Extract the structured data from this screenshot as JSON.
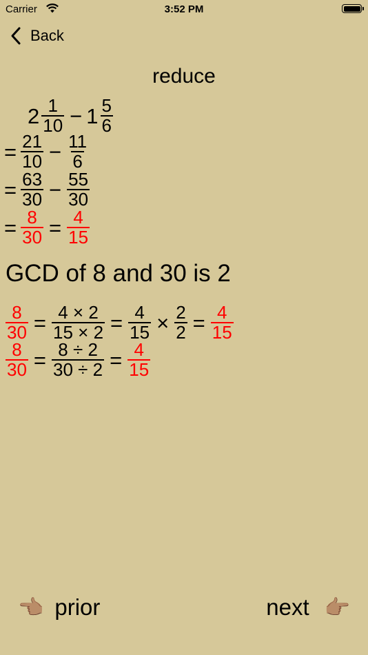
{
  "status": {
    "carrier": "Carrier",
    "time": "3:52 PM"
  },
  "nav": {
    "back_label": "Back"
  },
  "title": "reduce",
  "problem": {
    "a_whole": "2",
    "a_num": "1",
    "a_den": "10",
    "op": "−",
    "b_whole": "1",
    "b_num": "5",
    "b_den": "6"
  },
  "step1": {
    "eq": "=",
    "a_num": "21",
    "a_den": "10",
    "op": "−",
    "b_num": "11",
    "b_den": "6"
  },
  "step2": {
    "eq": "=",
    "a_num": "63",
    "a_den": "30",
    "op": "−",
    "b_num": "55",
    "b_den": "30"
  },
  "step3": {
    "eq": "=",
    "a_num": "8",
    "a_den": "30",
    "eq2": "=",
    "b_num": "4",
    "b_den": "15"
  },
  "gcd_text": "GCD of 8 and 30 is 2",
  "mult": {
    "f1_num": "8",
    "f1_den": "30",
    "eq": "=",
    "f2_num": "4 × 2",
    "f2_den": "15 × 2",
    "eq2": "=",
    "f3_num": "4",
    "f3_den": "15",
    "times": "×",
    "f4_num": "2",
    "f4_den": "2",
    "eq3": "=",
    "f5_num": "4",
    "f5_den": "15"
  },
  "div": {
    "f1_num": "8",
    "f1_den": "30",
    "eq": "=",
    "f2_num": "8 ÷ 2",
    "f2_den": "30 ÷ 2",
    "eq2": "=",
    "f3_num": "4",
    "f3_den": "15"
  },
  "footer": {
    "prior_label": "prior",
    "next_label": "next",
    "prior_icon": "👈🏽",
    "next_icon": "👉🏽"
  },
  "colors": {
    "background": "#d6c899",
    "highlight": "#ff0000"
  }
}
